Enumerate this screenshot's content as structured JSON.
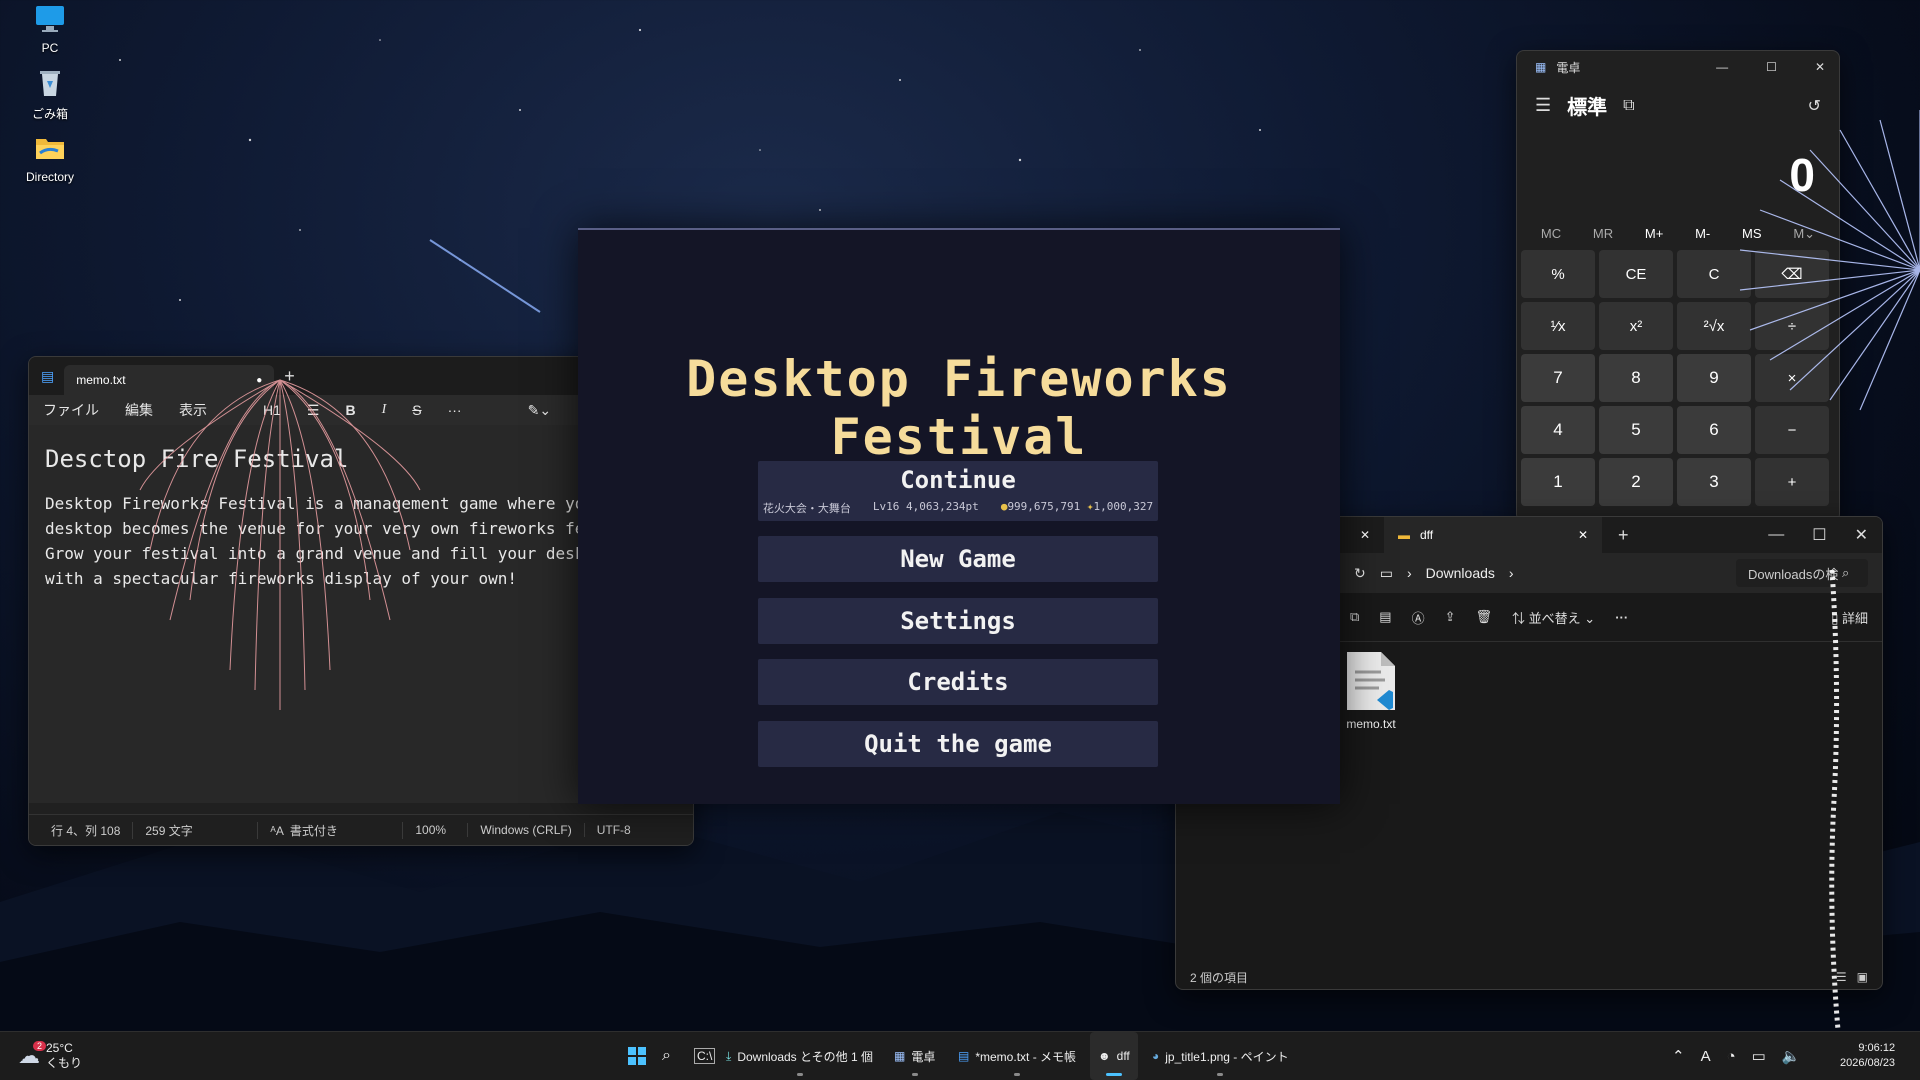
{
  "desktop": {
    "icons": [
      {
        "label": "PC",
        "icon": "monitor-icon"
      },
      {
        "label": "ごみ箱",
        "icon": "recycle-bin-icon"
      },
      {
        "label": "Directory",
        "icon": "folder-icon"
      }
    ]
  },
  "notepad": {
    "tab_title": "memo.txt",
    "menu": [
      "ファイル",
      "編集",
      "表示"
    ],
    "toolbar": {
      "heading": "H1",
      "bold": "B",
      "italic": "I",
      "strike": "S",
      "more": "···"
    },
    "heading": "Desctop Fire Festival",
    "body": "Desktop Fireworks Festival is a management game where your\ndesktop becomes the venue for your very own fireworks festival!\nGrow your festival into a grand venue and fill your desktop sky\nwith a spectacular fireworks display of your own!",
    "status": {
      "position": "行 4、列 108",
      "chars": "259 文字",
      "format": "書式付き",
      "zoom": "100%",
      "eol": "Windows (CRLF)",
      "encoding": "UTF-8"
    }
  },
  "calculator": {
    "title": "電卓",
    "mode": "標準",
    "display": "0",
    "memory": [
      "MC",
      "MR",
      "M+",
      "M-",
      "MS",
      "M⌄"
    ],
    "keys": [
      "%",
      "CE",
      "C",
      "⌫",
      "¹⁄x",
      "x²",
      "²√x",
      "÷",
      "7",
      "8",
      "9",
      "×",
      "4",
      "5",
      "6",
      "−",
      "1",
      "2",
      "3",
      "+"
    ]
  },
  "explorer": {
    "tab_title": "dff",
    "breadcrumb": "Downloads",
    "search_placeholder": "Downloadsの検索",
    "sort_label": "並べ替え",
    "details_label": "詳細",
    "file_name": "memo.txt",
    "status": "2 個の項目"
  },
  "game": {
    "title": "Desktop Fireworks Festival",
    "continue": {
      "label": "Continue",
      "venue": "花火大会・大舞台",
      "level": "Lv16 4,063,234pt",
      "coins": "999,675,791",
      "stars": "1,000,327"
    },
    "buttons": [
      "New Game",
      "Settings",
      "Credits",
      "Quit the game"
    ]
  },
  "taskbar": {
    "weather": {
      "temp": "25°C",
      "condition": "くもり",
      "badge": "2"
    },
    "apps": [
      {
        "label": "Downloads とその他 1 個",
        "icon": "download-icon"
      },
      {
        "label": "電卓",
        "icon": "calculator-icon"
      },
      {
        "label": "*memo.txt - メモ帳",
        "icon": "notepad-icon"
      },
      {
        "label": "dff",
        "icon": "game-icon"
      },
      {
        "label": "jp_title1.png - ペイント",
        "icon": "paint-icon"
      }
    ],
    "time": "9:06:12",
    "date": "2026/08/23",
    "ime": "A"
  },
  "colors": {
    "accent": "#4cc2ff",
    "game_title": "#f6dc9b",
    "game_button": "#272a44",
    "game_bg": "#141526"
  }
}
